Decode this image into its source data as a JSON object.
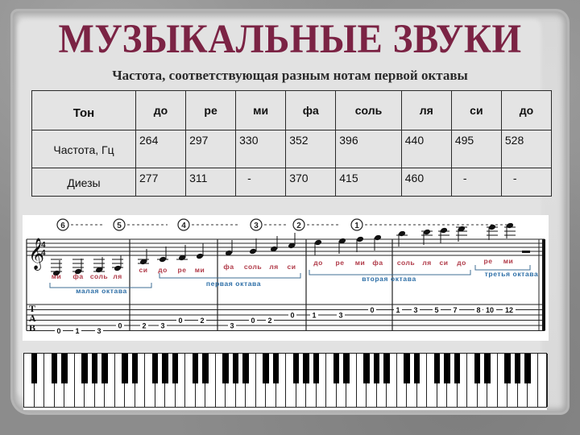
{
  "title": "МУЗЫКАЛЬНЫЕ ЗВУКИ",
  "subtitle": "Частота, соответствующая разным нотам первой октавы",
  "table": {
    "header_label": "Тон",
    "notes": [
      "до",
      "ре",
      "ми",
      "фа",
      "соль",
      "ля",
      "си",
      "до"
    ],
    "rows": [
      {
        "label": "Частота, Гц",
        "values": [
          "264",
          "297",
          "330",
          "352",
          "396",
          "440",
          "495",
          "528"
        ]
      },
      {
        "label": "Диезы",
        "values": [
          "277",
          "311",
          "-",
          "370",
          "415",
          "460",
          "-",
          "-"
        ]
      }
    ]
  },
  "notation": {
    "string_markers": [
      "6",
      "5",
      "4",
      "3",
      "2",
      "1"
    ],
    "tab_letters": [
      "T",
      "A",
      "B"
    ],
    "note_names": [
      "ми",
      "фа",
      "соль",
      "ля",
      "си",
      "до",
      "ре",
      "ми",
      "фа",
      "соль",
      "ля",
      "си",
      "до",
      "ре",
      "ми",
      "фа",
      "соль",
      "ля",
      "си",
      "до",
      "ре",
      "ми"
    ],
    "octaves": [
      "малая октава",
      "первая октава",
      "вторая октава",
      "третья октава"
    ],
    "tab_numbers": [
      "0",
      "1",
      "3",
      "0",
      "2",
      "3",
      "0",
      "2",
      "3",
      "0",
      "2",
      "0",
      "1",
      "3",
      "0",
      "1",
      "3",
      "5",
      "7",
      "8",
      "10",
      "12"
    ],
    "colors": {
      "note_name": "#b03a48",
      "octave": "#2e6fa7"
    }
  },
  "keyboard": {
    "white_keys": 52,
    "first_note": "A"
  }
}
